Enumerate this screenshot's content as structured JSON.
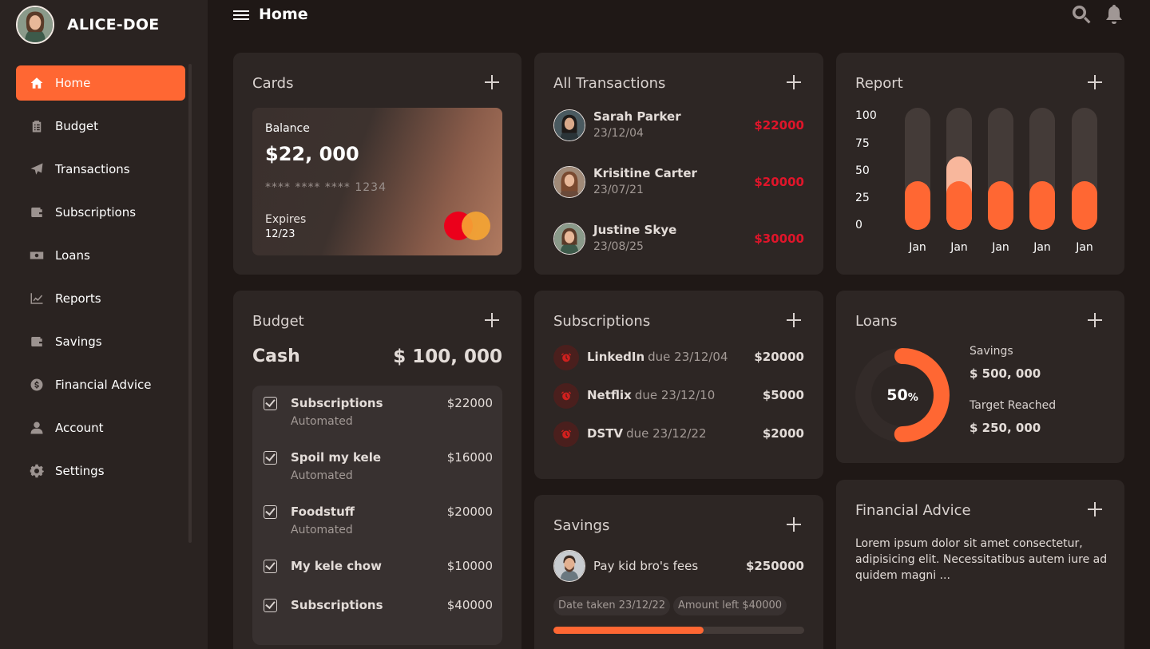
{
  "profile": {
    "name": "ALICE-DOE"
  },
  "header": {
    "title": "Home"
  },
  "sidebar": {
    "items": [
      {
        "label": "Home",
        "icon": "home-icon"
      },
      {
        "label": "Budget",
        "icon": "clipboard-icon"
      },
      {
        "label": "Transactions",
        "icon": "paper-plane-icon"
      },
      {
        "label": "Subscriptions",
        "icon": "wallet-icon"
      },
      {
        "label": "Loans",
        "icon": "money-icon"
      },
      {
        "label": "Reports",
        "icon": "chart-line-icon"
      },
      {
        "label": "Savings",
        "icon": "wallet-icon"
      },
      {
        "label": "Financial Advice",
        "icon": "dollar-circle-icon"
      },
      {
        "label": "Account",
        "icon": "user-icon"
      },
      {
        "label": "Settings",
        "icon": "gear-icon"
      }
    ]
  },
  "cards": {
    "title": "Cards",
    "balance_label": "Balance",
    "balance": "$22, 000",
    "number": "**** **** **** 1234",
    "expires_label": "Expires",
    "expires": "12/23"
  },
  "transactions": {
    "title": "All Transactions",
    "items": [
      {
        "name": "Sarah Parker",
        "date": "23/12/04",
        "amount": "$22000"
      },
      {
        "name": "Krisitine Carter",
        "date": "23/07/21",
        "amount": "$20000"
      },
      {
        "name": "Justine Skye",
        "date": "23/08/25",
        "amount": "$30000"
      }
    ]
  },
  "report": {
    "title": "Report",
    "y_ticks": [
      "100",
      "75",
      "50",
      "25",
      "0"
    ],
    "x_labels": [
      "Jan",
      "Jan",
      "Jan",
      "Jan",
      "Jan"
    ]
  },
  "chart_data": {
    "type": "bar",
    "categories": [
      "Jan",
      "Jan",
      "Jan",
      "Jan",
      "Jan"
    ],
    "series": [
      {
        "values": [
          40,
          40,
          40,
          40,
          40
        ]
      },
      {
        "values": [
          0,
          20,
          0,
          0,
          0
        ]
      }
    ],
    "ylim": [
      0,
      100
    ],
    "y_ticks": [
      100,
      75,
      50,
      25,
      0
    ],
    "colors": [
      "#ff6733",
      "#f8b79c"
    ]
  },
  "budget": {
    "title": "Budget",
    "cash_label": "Cash",
    "cash_value": "$ 100, 000",
    "items": [
      {
        "name": "Subscriptions",
        "sub": "Automated",
        "amount": "$22000"
      },
      {
        "name": "Spoil my kele",
        "sub": "Automated",
        "amount": "$16000"
      },
      {
        "name": "Foodstuff",
        "sub": "Automated",
        "amount": "$20000"
      },
      {
        "name": "My kele chow",
        "sub": "",
        "amount": "$10000"
      },
      {
        "name": "Subscriptions",
        "sub": "",
        "amount": "$40000"
      }
    ]
  },
  "subscriptions": {
    "title": "Subscriptions",
    "items": [
      {
        "name": "LinkedIn",
        "due": "due 23/12/04",
        "amount": "$20000"
      },
      {
        "name": "Netflix",
        "due": "due 23/12/10",
        "amount": "$5000"
      },
      {
        "name": "DSTV",
        "due": "due 23/12/22",
        "amount": "$2000"
      }
    ]
  },
  "loans": {
    "title": "Loans",
    "percent": "50",
    "percent_sign": "%",
    "progress": 0.5,
    "savings_label": "Savings",
    "savings_value": "$ 500, 000",
    "target_label": "Target Reached",
    "target_value": "$ 250, 000"
  },
  "savings": {
    "title": "Savings",
    "item_name": "Pay kid bro's fees",
    "item_amount": "$250000",
    "date_taken": "Date taken 23/12/22",
    "amount_left": "Amount left $40000",
    "progress": 0.6
  },
  "advice": {
    "title": "Financial Advice",
    "text": "Lorem ipsum dolor sit amet consectetur, adipisicing elit. Necessitatibus autem iure ad quidem magni ..."
  },
  "colors": {
    "accent": "#ff6733",
    "danger": "#e0152a",
    "background": "#1f1816",
    "card": "#2d2624"
  }
}
